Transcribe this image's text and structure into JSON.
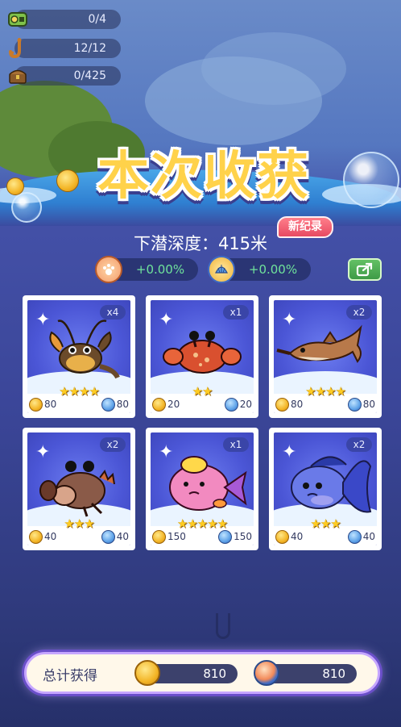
{
  "resources": [
    {
      "icon": "medal-icon",
      "value": "0/4"
    },
    {
      "icon": "fishhook-icon",
      "value": "12/12"
    },
    {
      "icon": "treasure-chest-icon",
      "value": "0/425"
    }
  ],
  "title": "本次收获",
  "depth_text": "下潜深度：415米",
  "record_badge": "新纪录",
  "bonuses": [
    {
      "icon": "paw-icon",
      "value": "+0.00%"
    },
    {
      "icon": "shell-icon",
      "value": "+0.00%"
    }
  ],
  "share_icon": "share-icon",
  "catches": [
    {
      "creature": "lobster",
      "qty": "x4",
      "stars": 4,
      "coins": "80",
      "shells": "80"
    },
    {
      "creature": "red-crab",
      "qty": "x1",
      "stars": 2,
      "coins": "20",
      "shells": "20"
    },
    {
      "creature": "sawfish",
      "qty": "x2",
      "stars": 4,
      "coins": "80",
      "shells": "80"
    },
    {
      "creature": "brown-crab",
      "qty": "x2",
      "stars": 3,
      "coins": "40",
      "shells": "40"
    },
    {
      "creature": "pink-fish",
      "qty": "x1",
      "stars": 5,
      "coins": "150",
      "shells": "150"
    },
    {
      "creature": "blue-goldfish",
      "qty": "x2",
      "stars": 3,
      "coins": "40",
      "shells": "40"
    }
  ],
  "total": {
    "label": "总计获得",
    "coins": "810",
    "shells": "810"
  },
  "colors": {
    "accent_gold": "#ffd24a",
    "bonus_green": "#6fe39b",
    "record_red": "#e84a62",
    "card_blue": "#4b56d6"
  }
}
